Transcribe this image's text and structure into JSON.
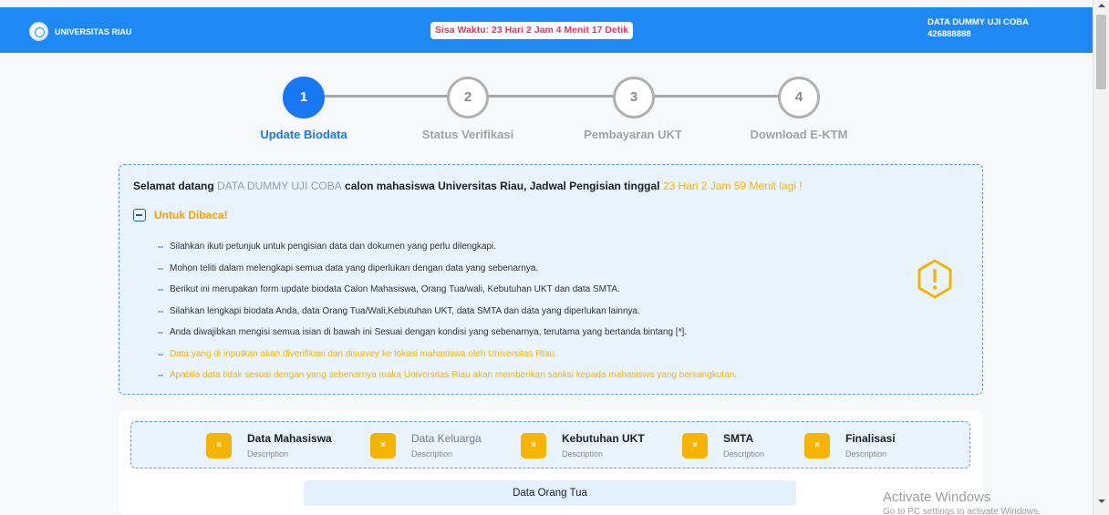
{
  "header": {
    "brand": "UNIVERSITAS RIAU",
    "timer": "Sisa Waktu: 23 Hari 2 Jam 4 Menit 17 Detik",
    "user_name": "DATA DUMMY UJI COBA",
    "user_id": "426888888",
    "color": "#1e88f5"
  },
  "steps": [
    {
      "number": "1",
      "label": "Update Biodata",
      "active": true
    },
    {
      "number": "2",
      "label": "Status Verifikasi",
      "active": false
    },
    {
      "number": "3",
      "label": "Pembayaran UKT",
      "active": false
    },
    {
      "number": "4",
      "label": "Download E-KTM",
      "active": false
    }
  ],
  "info": {
    "welcome_prefix": "Selamat datang ",
    "welcome_name": "DATA DUMMY UJI COBA",
    "welcome_middle": " calon mahasiswa Universitas Riau, Jadwal Pengisian tinggal ",
    "welcome_deadline": "23 Hari 2 Jam 59 Menit lagi !",
    "read_title": "Untuk Dibaca!",
    "items": [
      "Silahkan ikuti petunjuk untuk pengisian data dan dokumen yang perlu dilengkapi.",
      "Mohon teliti dalam melengkapi semua data yang diperlukan dengan data yang sebenarnya.",
      "Berikut ini merupakan form update biodata Calon Mahasiswa, Orang Tua/wali, Kebutuhan UKT dan data SMTA.",
      "Silahkan lengkapi biodata Anda, data Orang Tua/Wali,Kebutuhan UKT, data SMTA dan data yang diperlukan lainnya.",
      "Anda diwajibkan mengisi semua isian di bawah ini Sesuai dengan kondisi yang sebenarnya, terutama yang bertanda bintang [*].",
      "Data yang di inputkan akan diverifikasi dan disurvey ke lokasi mahasiswa oleh Universitas Riau.",
      "Apabila data tidak sesuai dengan yang sebenarnya maka Universitas Riau akan memberikan sanksi kepada mahasiswa yang bersangkutan."
    ],
    "warning_color": "#f4b400"
  },
  "form_tabs": [
    {
      "icon": "×",
      "title": "Data Mahasiswa",
      "desc": "Description"
    },
    {
      "icon": "×",
      "title": "Data Keluarga",
      "desc": "Description"
    },
    {
      "icon": "×",
      "title": "Kebutuhan UKT",
      "desc": "Description"
    },
    {
      "icon": "×",
      "title": "SMTA",
      "desc": "Description"
    },
    {
      "icon": "×",
      "title": "Finalisasi",
      "desc": "Description"
    }
  ],
  "section_title": "Data Orang Tua",
  "watermark": {
    "line1": "Activate Windows",
    "line2": "Go to PC settings to activate Windows."
  }
}
